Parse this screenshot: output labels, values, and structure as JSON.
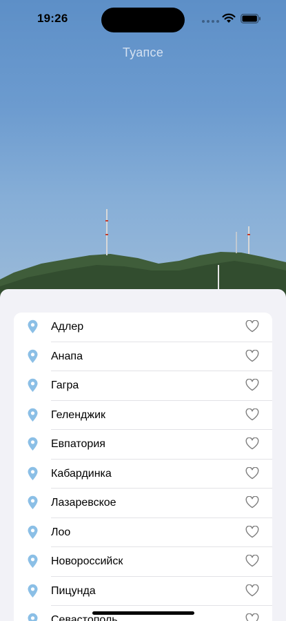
{
  "status_bar": {
    "time": "19:26"
  },
  "header": {
    "city_title": "Туапсе"
  },
  "cities": [
    {
      "name": "Адлер"
    },
    {
      "name": "Анапа"
    },
    {
      "name": "Гагра"
    },
    {
      "name": "Геленджик"
    },
    {
      "name": "Евпатория"
    },
    {
      "name": "Кабардинка"
    },
    {
      "name": "Лазаревское"
    },
    {
      "name": "Лоо"
    },
    {
      "name": "Новороссийск"
    },
    {
      "name": "Пицунда"
    },
    {
      "name": "Севастополь"
    }
  ],
  "icons": {
    "row_leading": "location-pin-icon",
    "row_trailing": "heart-outline-icon"
  },
  "colors": {
    "pin": "#8bbfe6",
    "heart": "#7d7d7d",
    "sheet_bg": "#f2f2f7"
  }
}
